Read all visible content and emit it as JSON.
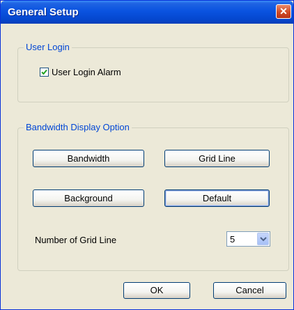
{
  "window": {
    "title": "General Setup"
  },
  "user_login": {
    "group_label": "User Login",
    "alarm_label": "User Login Alarm",
    "alarm_checked": true
  },
  "bandwidth": {
    "group_label": "Bandwidth Display Option",
    "buttons": {
      "bandwidth": "Bandwidth",
      "grid_line": "Grid Line",
      "background": "Background",
      "default": "Default"
    },
    "grid_count_label": "Number of Grid Line",
    "grid_count_value": "5"
  },
  "footer": {
    "ok_label": "OK",
    "cancel_label": "Cancel"
  },
  "icons": {
    "close": "close-icon",
    "check": "check-icon",
    "dropdown": "chevron-down-icon"
  },
  "colors": {
    "title_bar": "#0a53e0",
    "group_label": "#0046d5",
    "dialog_bg": "#ece9d8"
  }
}
